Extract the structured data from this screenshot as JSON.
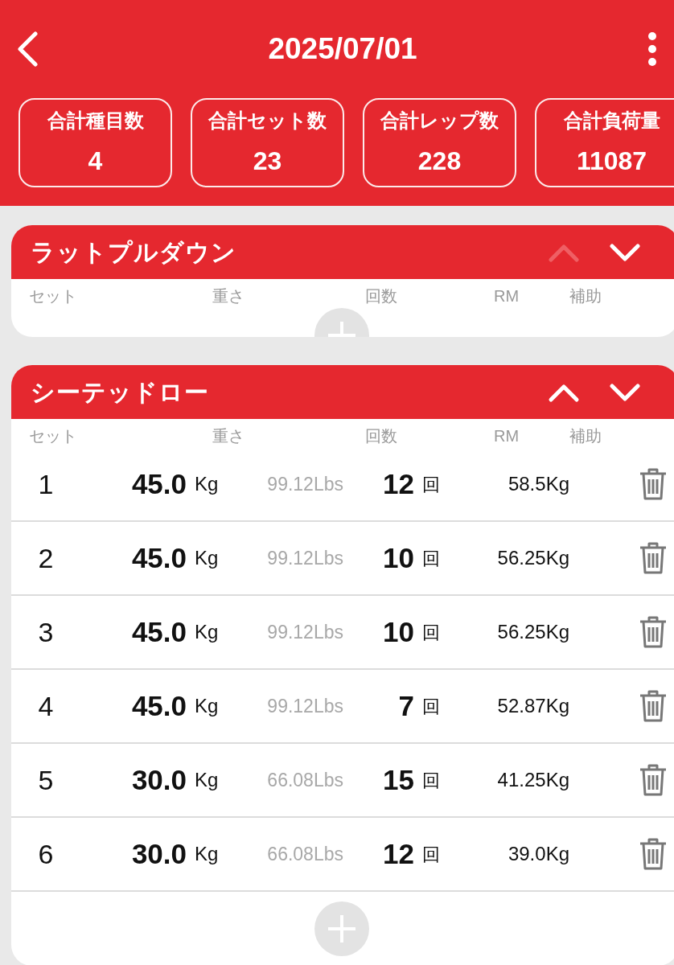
{
  "header": {
    "title": "2025/07/01"
  },
  "stats": [
    {
      "label": "合計種目数",
      "value": "4"
    },
    {
      "label": "合計セット数",
      "value": "23"
    },
    {
      "label": "合計レップ数",
      "value": "228"
    },
    {
      "label": "合計負荷量",
      "value": "11087"
    }
  ],
  "exercises": [
    {
      "name": "ラットプルダウン",
      "expanded": false,
      "up_disabled": true,
      "columns": [
        "セット",
        "重さ",
        "回数",
        "RM",
        "補助"
      ]
    },
    {
      "name": "シーテッドロー",
      "expanded": true,
      "up_disabled": false,
      "columns": [
        "セット",
        "重さ",
        "回数",
        "RM",
        "補助"
      ],
      "sets": [
        {
          "set": "1",
          "weight": "45.0",
          "weight_unit": "Kg",
          "lbs": "99.12Lbs",
          "reps": "12",
          "reps_unit": "回",
          "rm": "58.5Kg"
        },
        {
          "set": "2",
          "weight": "45.0",
          "weight_unit": "Kg",
          "lbs": "99.12Lbs",
          "reps": "10",
          "reps_unit": "回",
          "rm": "56.25Kg"
        },
        {
          "set": "3",
          "weight": "45.0",
          "weight_unit": "Kg",
          "lbs": "99.12Lbs",
          "reps": "10",
          "reps_unit": "回",
          "rm": "56.25Kg"
        },
        {
          "set": "4",
          "weight": "45.0",
          "weight_unit": "Kg",
          "lbs": "99.12Lbs",
          "reps": "7",
          "reps_unit": "回",
          "rm": "52.87Kg"
        },
        {
          "set": "5",
          "weight": "30.0",
          "weight_unit": "Kg",
          "lbs": "66.08Lbs",
          "reps": "15",
          "reps_unit": "回",
          "rm": "41.25Kg"
        },
        {
          "set": "6",
          "weight": "30.0",
          "weight_unit": "Kg",
          "lbs": "66.08Lbs",
          "reps": "12",
          "reps_unit": "回",
          "rm": "39.0Kg"
        }
      ]
    }
  ]
}
